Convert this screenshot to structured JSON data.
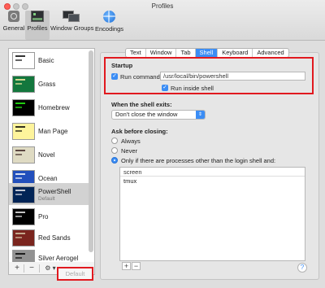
{
  "window": {
    "title": "Profiles"
  },
  "toolbar": {
    "items": [
      {
        "label": "General",
        "icon": "general-icon"
      },
      {
        "label": "Profiles",
        "icon": "profiles-icon",
        "selected": true
      },
      {
        "label": "Window Groups",
        "icon": "window-groups-icon"
      },
      {
        "label": "Encodings",
        "icon": "globe-icon"
      }
    ]
  },
  "profiles": [
    {
      "name": "Basic",
      "thumb_bg": "#ffffff",
      "thumb_fg": "#000000"
    },
    {
      "name": "Grass",
      "thumb_bg": "#13773d",
      "thumb_fg": "#fff0a5"
    },
    {
      "name": "Homebrew",
      "thumb_bg": "#000000",
      "thumb_fg": "#28fe14"
    },
    {
      "name": "Man Page",
      "thumb_bg": "#fef49c",
      "thumb_fg": "#000000"
    },
    {
      "name": "Novel",
      "thumb_bg": "#dfdbc3",
      "thumb_fg": "#3b2322"
    },
    {
      "name": "Ocean",
      "thumb_bg": "#224fbc",
      "thumb_fg": "#ffffff"
    },
    {
      "name": "PowerShell",
      "subtitle": "Default",
      "thumb_bg": "#012456",
      "thumb_fg": "#eeedf0",
      "selected": true
    },
    {
      "name": "Pro",
      "thumb_bg": "#000000",
      "thumb_fg": "#f2f2f2"
    },
    {
      "name": "Red Sands",
      "thumb_bg": "#7a251e",
      "thumb_fg": "#d7c9a7"
    },
    {
      "name": "Silver Aerogel",
      "thumb_bg": "#929292",
      "thumb_fg": "#000000"
    }
  ],
  "list_controls": {
    "add": "+",
    "remove": "−",
    "gear": "⚙ ▾",
    "default_label": "Default"
  },
  "tabs": [
    {
      "label": "Text"
    },
    {
      "label": "Window"
    },
    {
      "label": "Tab"
    },
    {
      "label": "Shell",
      "active": true
    },
    {
      "label": "Keyboard"
    },
    {
      "label": "Advanced"
    }
  ],
  "startup": {
    "title": "Startup",
    "run_command_label": "Run command:",
    "run_command_checked": true,
    "command_value": "/usr/local/bin/powershell",
    "inside_shell_label": "Run inside shell",
    "inside_shell_checked": true
  },
  "shell_exit": {
    "title": "When the shell exits:",
    "selected": "Don't close the window"
  },
  "ask_closing": {
    "title": "Ask before closing:",
    "options": [
      {
        "label": "Always",
        "selected": false
      },
      {
        "label": "Never",
        "selected": false
      },
      {
        "label": "Only if there are processes other than the login shell and:",
        "selected": true
      }
    ],
    "process_list": [
      "screen",
      "tmux"
    ]
  },
  "process_controls": {
    "add": "+",
    "remove": "−"
  },
  "help": "?",
  "colors": {
    "accent": "#3b8df5",
    "annotation_red": "#e1191f"
  }
}
